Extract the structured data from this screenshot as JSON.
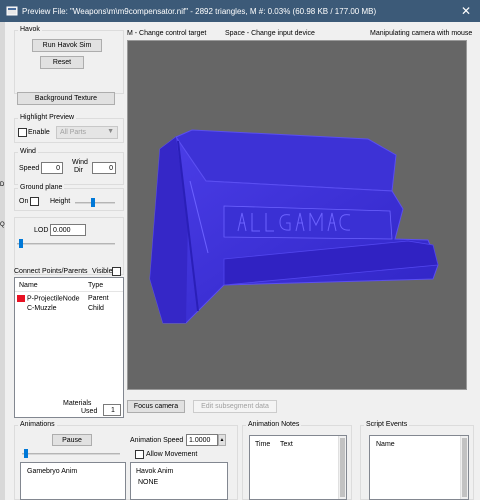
{
  "window": {
    "title": "Preview File: \"Weapons\\m\\m9compensator.nif\" - 2892 triangles, M #: 0.03% (60.98 KB / 177.00 MB)",
    "close_glyph": "✕"
  },
  "havok": {
    "title": "Havok",
    "run_button": "Run Havok Sim",
    "reset_button": "Reset"
  },
  "background_texture_button": "Background Texture",
  "highlight": {
    "title": "Highlight Preview",
    "enable_label": "Enable",
    "parts_select": "All Parts"
  },
  "wind": {
    "title": "Wind",
    "speed_label": "Speed",
    "speed_value": "0",
    "dir_label_1": "Wind",
    "dir_label_2": "Dir",
    "dir_value": "0"
  },
  "ground_plane": {
    "title": "Ground plane",
    "on_label": "On",
    "height_label": "Height"
  },
  "lod": {
    "label": "LOD",
    "value": "0.000"
  },
  "connect_points": {
    "title": "Connect Points/Parents",
    "visible_label": "Visible",
    "col_name": "Name",
    "col_type": "Type",
    "rows": [
      {
        "name": "P-ProjectileNode",
        "type": "Parent"
      },
      {
        "name": "C-Muzzle",
        "type": "Child"
      }
    ]
  },
  "materials": {
    "label_1": "Materials",
    "label_2": "Used",
    "value": "1"
  },
  "focus_camera_button": "Focus camera",
  "edit_subsegment_button": "Edit subsegment data",
  "viewport_hints": {
    "left": "M - Change control target",
    "center": "Space - Change input device",
    "right": "Manipulating camera with mouse"
  },
  "animations": {
    "title": "Animations",
    "pause_button": "Pause",
    "speed_label": "Animation Speed",
    "speed_value": "1.0000",
    "allow_movement_label": "Allow Movement",
    "list_item": "Gamebryo Anim",
    "havok_anim_label": "Havok Anim",
    "havok_anim_value": "NONE"
  },
  "animation_notes": {
    "title": "Animation Notes",
    "col_time": "Time",
    "col_text": "Text"
  },
  "script_events": {
    "title": "Script Events",
    "col_name": "Name"
  },
  "side_fragments": {
    "a": "D",
    "b": "Q"
  },
  "colors": {
    "titlebar": "#3c5a78",
    "model_fill": "#3a2fd8",
    "viewport_bg": "#666666",
    "highlight_red": "#e81123"
  }
}
